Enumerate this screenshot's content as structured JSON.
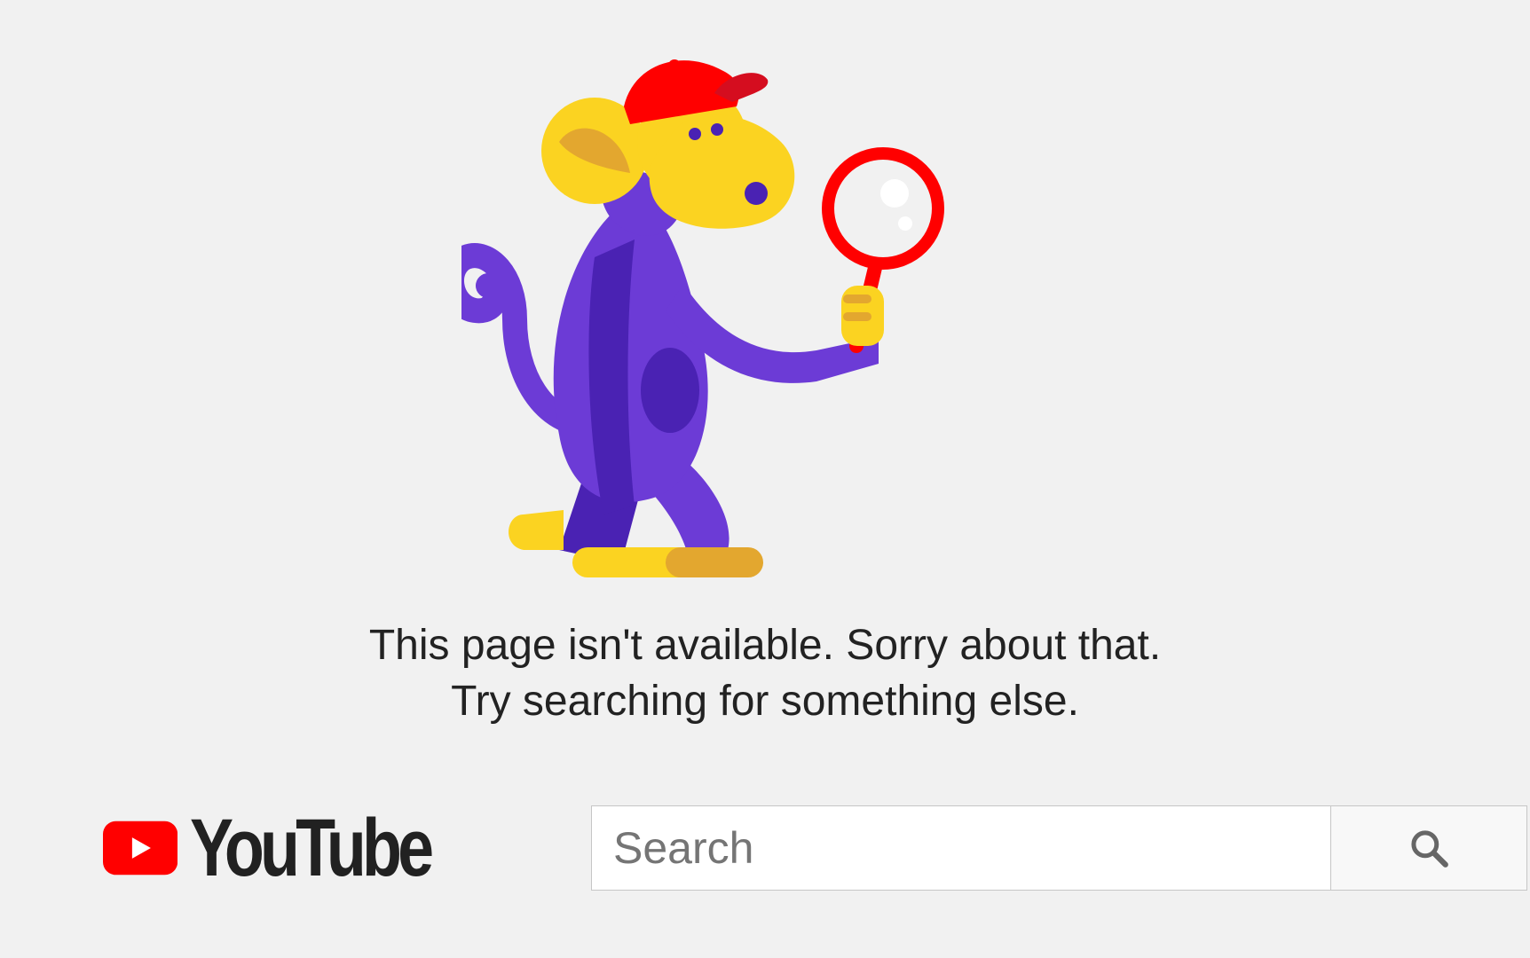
{
  "illustration": {
    "icon": "detective-monkey-icon",
    "colors": {
      "body": "#6c3bd6",
      "body_shadow": "#4a22b3",
      "face": "#fbd321",
      "face_shadow": "#e3a72f",
      "cap": "#ff0000",
      "cap_brim": "#d50d1f",
      "magnifier": "#ff0000"
    }
  },
  "message": {
    "line1": "This page isn't available. Sorry about that.",
    "line2": "Try searching for something else."
  },
  "logo": {
    "icon": "youtube-play-icon",
    "wordmark": "YouTube",
    "colors": {
      "play_background": "#ff0000",
      "play_triangle": "#ffffff",
      "wordmark": "#212121"
    }
  },
  "search": {
    "placeholder": "Search",
    "value": "",
    "button_icon": "search-icon",
    "button_icon_color": "#666666"
  }
}
